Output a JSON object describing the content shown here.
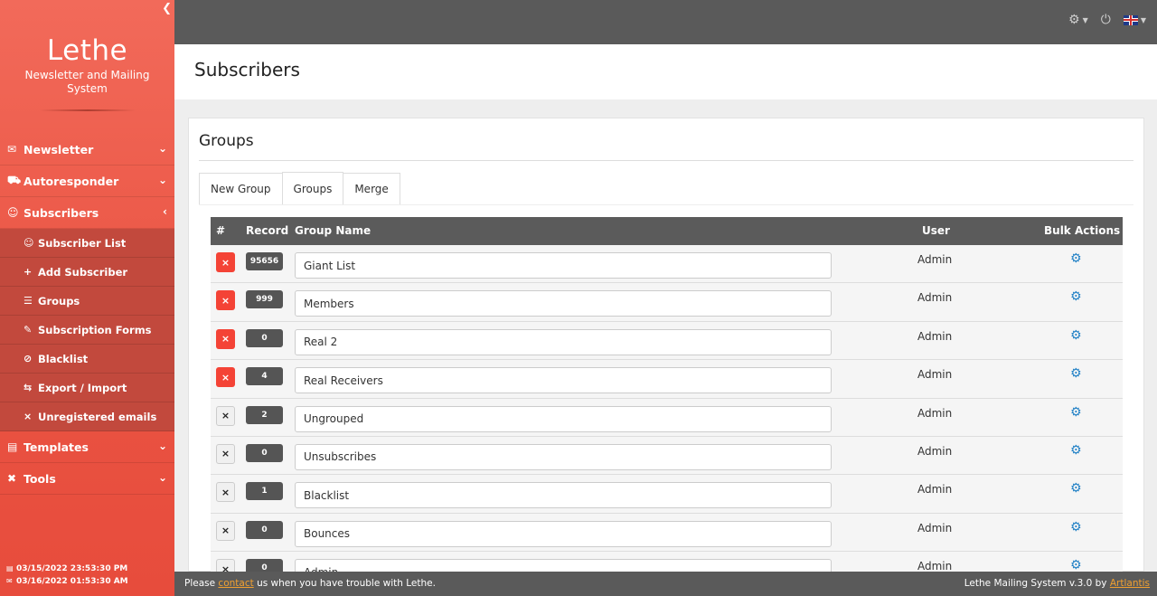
{
  "sidebar": {
    "brand": "Lethe",
    "subtitle": "Newsletter and Mailing System",
    "menu": [
      {
        "icon": "envelope-icon",
        "label": "Newsletter"
      },
      {
        "icon": "truck-icon",
        "label": "Autoresponder"
      },
      {
        "icon": "users-icon",
        "label": "Subscribers"
      },
      {
        "icon": "paint-roller-icon",
        "label": "Templates"
      },
      {
        "icon": "tools-icon",
        "label": "Tools"
      }
    ],
    "submenu": [
      {
        "icon": "users-icon",
        "label": "Subscriber List"
      },
      {
        "icon": "plus-icon",
        "label": "Add Subscriber"
      },
      {
        "icon": "list-icon",
        "label": "Groups"
      },
      {
        "icon": "edit-icon",
        "label": "Subscription Forms"
      },
      {
        "icon": "ban-icon",
        "label": "Blacklist"
      },
      {
        "icon": "exchange-icon",
        "label": "Export / Import"
      },
      {
        "icon": "user-slash-icon",
        "label": "Unregistered emails"
      }
    ],
    "footer": {
      "time1": "03/15/2022 23:53:30 PM",
      "time2": "03/16/2022 01:53:30 AM"
    }
  },
  "page": {
    "title": "Subscribers"
  },
  "panel": {
    "title": "Groups",
    "tabs": [
      "New Group",
      "Groups",
      "Merge"
    ],
    "active_tab": "Groups"
  },
  "table": {
    "headers": {
      "num": "#",
      "record": "Record",
      "group_name": "Group Name",
      "user": "User",
      "bulk": "Bulk Actions"
    },
    "rows": [
      {
        "delete": "×",
        "record": "95656",
        "name": "Giant List",
        "user": "Admin",
        "deletable": true
      },
      {
        "delete": "×",
        "record": "999",
        "name": "Members",
        "user": "Admin",
        "deletable": true
      },
      {
        "delete": "×",
        "record": "0",
        "name": "Real 2",
        "user": "Admin",
        "deletable": true
      },
      {
        "delete": "×",
        "record": "4",
        "name": "Real Receivers",
        "user": "Admin",
        "deletable": true
      },
      {
        "delete": "×",
        "record": "2",
        "name": "Ungrouped",
        "user": "Admin",
        "deletable": false
      },
      {
        "delete": "×",
        "record": "0",
        "name": "Unsubscribes",
        "user": "Admin",
        "deletable": false
      },
      {
        "delete": "×",
        "record": "1",
        "name": "Blacklist",
        "user": "Admin",
        "deletable": false
      },
      {
        "delete": "×",
        "record": "0",
        "name": "Bounces",
        "user": "Admin",
        "deletable": false
      },
      {
        "delete": "×",
        "record": "0",
        "name": "Admin",
        "user": "Admin",
        "deletable": false
      }
    ]
  },
  "footer": {
    "please": "Please",
    "contact": "contact",
    "rest": "us when you have trouble with Lethe.",
    "version": "Lethe Mailing System v.3.0 by",
    "author": "Artlantis"
  },
  "colors": {
    "sidebar": "#e74c3c",
    "topbar": "#5a5a5a",
    "delete_red": "#f44336",
    "gear_blue": "#1e7fc5",
    "link_orange": "#f0a030"
  }
}
